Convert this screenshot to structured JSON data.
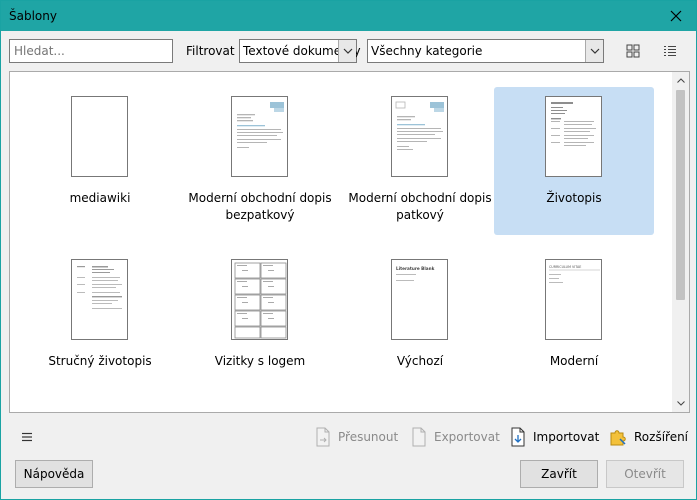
{
  "window": {
    "title": "Šablony"
  },
  "toolbar": {
    "search_placeholder": "Hledat...",
    "filter_label": "Filtrovat",
    "type_value": "Textové dokumenty",
    "category_value": "Všechny kategorie"
  },
  "templates": [
    {
      "name": "mediawiki",
      "selected": false
    },
    {
      "name": "Moderní obchodní dopis bezpatkový",
      "selected": false
    },
    {
      "name": "Moderní obchodní dopis patkový",
      "selected": false
    },
    {
      "name": "Životopis",
      "selected": true
    },
    {
      "name": "Stručný životopis",
      "selected": false
    },
    {
      "name": "Vizitky s logem",
      "selected": false
    },
    {
      "name": "Výchozí",
      "selected": false
    },
    {
      "name": "Moderní",
      "selected": false
    }
  ],
  "thumbs": {
    "vychozi_heading": "Literature Blank",
    "moderni_heading": "CURRICULUM VITAE"
  },
  "actions": {
    "move": "Přesunout",
    "export": "Exportovat",
    "import": "Importovat",
    "extensions": "Rozšíření"
  },
  "buttons": {
    "help": "Nápověda",
    "close": "Zavřít",
    "open": "Otevřít"
  },
  "colors": {
    "titlebar": "#1fa5a5",
    "selection": "#c7def4"
  }
}
